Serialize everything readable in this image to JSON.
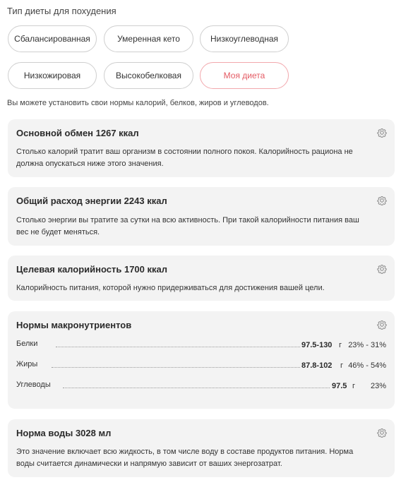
{
  "section_title": "Тип диеты для похудения",
  "diet_types": [
    {
      "label": "Сбалансированная",
      "active": false
    },
    {
      "label": "Умеренная кето",
      "active": false
    },
    {
      "label": "Низкоуглеводная",
      "active": false
    },
    {
      "label": "Низкожировая",
      "active": false
    },
    {
      "label": "Высокобелковая",
      "active": false
    },
    {
      "label": "Моя диета",
      "active": true
    }
  ],
  "hint": "Вы можете установить свои нормы калорий, белков, жиров и углеводов.",
  "cards": {
    "bmr": {
      "title": "Основной обмен 1267 ккал",
      "text_line1": "Столько калорий тратит ваш организм в состоянии полного покоя. Калорийность рациона не",
      "text_line2": "должна опускаться ниже этого значения."
    },
    "tdee": {
      "title": "Общий расход энергии 2243 ккал",
      "text_line1": "Столько энергии вы тратите за сутки на всю активность. При такой калорийности питания ваш",
      "text_line2": "вес не будет меняться."
    },
    "target": {
      "title": "Целевая калорийность 1700 ккал",
      "text_line1": "Калорийность питания, которой нужно придерживаться для достижения вашей цели."
    },
    "macros": {
      "title": "Нормы макронутриентов",
      "rows": [
        {
          "name": "Белки",
          "amount": "97.5-130",
          "unit": "г",
          "percent": "23% - 31%"
        },
        {
          "name": "Жиры",
          "amount": "87.8-102",
          "unit": "г",
          "percent": "46% - 54%"
        },
        {
          "name": "Углеводы",
          "amount": "97.5",
          "unit": "г",
          "percent": "23%"
        }
      ]
    },
    "water": {
      "title": "Норма воды 3028 мл",
      "text_line1": "Это значение включает всю жидкость, в том числе воду в составе продуктов питания. Норма",
      "text_line2": "воды считается динамически и напрямую зависит от ваших энергозатрат."
    }
  },
  "icons": {
    "settings": "gear-icon"
  },
  "colors": {
    "accent": "#e45a63",
    "accent_border": "#f2a8ad",
    "card_bg": "#f3f3f3"
  }
}
